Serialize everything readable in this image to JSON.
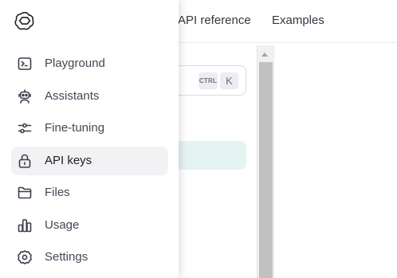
{
  "topnav": {
    "api_reference": "API reference",
    "examples": "Examples"
  },
  "search": {
    "shortcut_ctrl": "CTRL",
    "shortcut_key": "K"
  },
  "sidebar": {
    "items": [
      {
        "label": "Playground",
        "icon": "terminal-icon",
        "active": false
      },
      {
        "label": "Assistants",
        "icon": "robot-icon",
        "active": false
      },
      {
        "label": "Fine-tuning",
        "icon": "sliders-icon",
        "active": false
      },
      {
        "label": "API keys",
        "icon": "lock-icon",
        "active": true
      },
      {
        "label": "Files",
        "icon": "folder-icon",
        "active": false
      },
      {
        "label": "Usage",
        "icon": "bar-chart-icon",
        "active": false
      },
      {
        "label": "Settings",
        "icon": "gear-icon",
        "active": false
      }
    ]
  },
  "colors": {
    "active_item_bg": "#f2f2f4",
    "highlight_row": "#e6f3f3",
    "text": "#444654"
  }
}
